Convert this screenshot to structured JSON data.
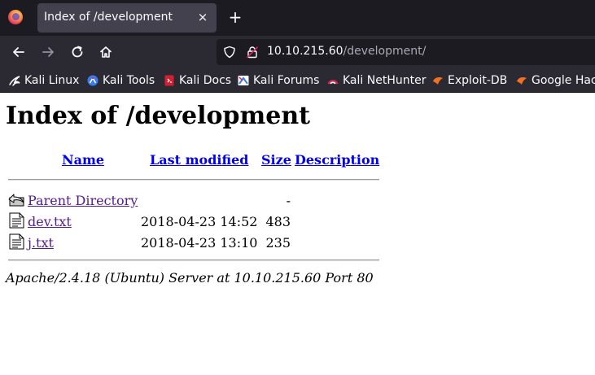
{
  "browser": {
    "tab": {
      "title": "Index of /development",
      "close": "×"
    },
    "new_tab": "+",
    "address": {
      "host": "10.10.215.60",
      "path": "/development/"
    },
    "bookmarks": [
      {
        "label": "Kali Linux",
        "icon": "kali-dragon-icon"
      },
      {
        "label": "Kali Tools",
        "icon": "kali-tools-icon"
      },
      {
        "label": "Kali Docs",
        "icon": "kali-docs-icon"
      },
      {
        "label": "Kali Forums",
        "icon": "kali-forums-icon"
      },
      {
        "label": "Kali NetHunter",
        "icon": "kali-nethunter-icon"
      },
      {
        "label": "Exploit-DB",
        "icon": "exploit-db-icon"
      },
      {
        "label": "Google Hacking DB",
        "icon": "ghdb-icon"
      }
    ]
  },
  "page": {
    "heading": "Index of /development",
    "columns": {
      "name": "Name",
      "modified": "Last modified",
      "size": "Size",
      "description": "Description"
    },
    "rows": [
      {
        "name": "Parent Directory",
        "modified": "",
        "size": "-",
        "icon": "back-folder-icon"
      },
      {
        "name": "dev.txt",
        "modified": "2018-04-23 14:52",
        "size": "483",
        "icon": "text-file-icon"
      },
      {
        "name": "j.txt",
        "modified": "2018-04-23 13:10",
        "size": "235",
        "icon": "text-file-icon"
      }
    ],
    "footer": "Apache/2.4.18 (Ubuntu) Server at 10.10.215.60 Port 80"
  },
  "colors": {
    "tabstrip_bg": "#1c1b22",
    "toolbar_bg": "#2b2a33",
    "link": "#0000ee",
    "visited_link": "#551a8b"
  }
}
